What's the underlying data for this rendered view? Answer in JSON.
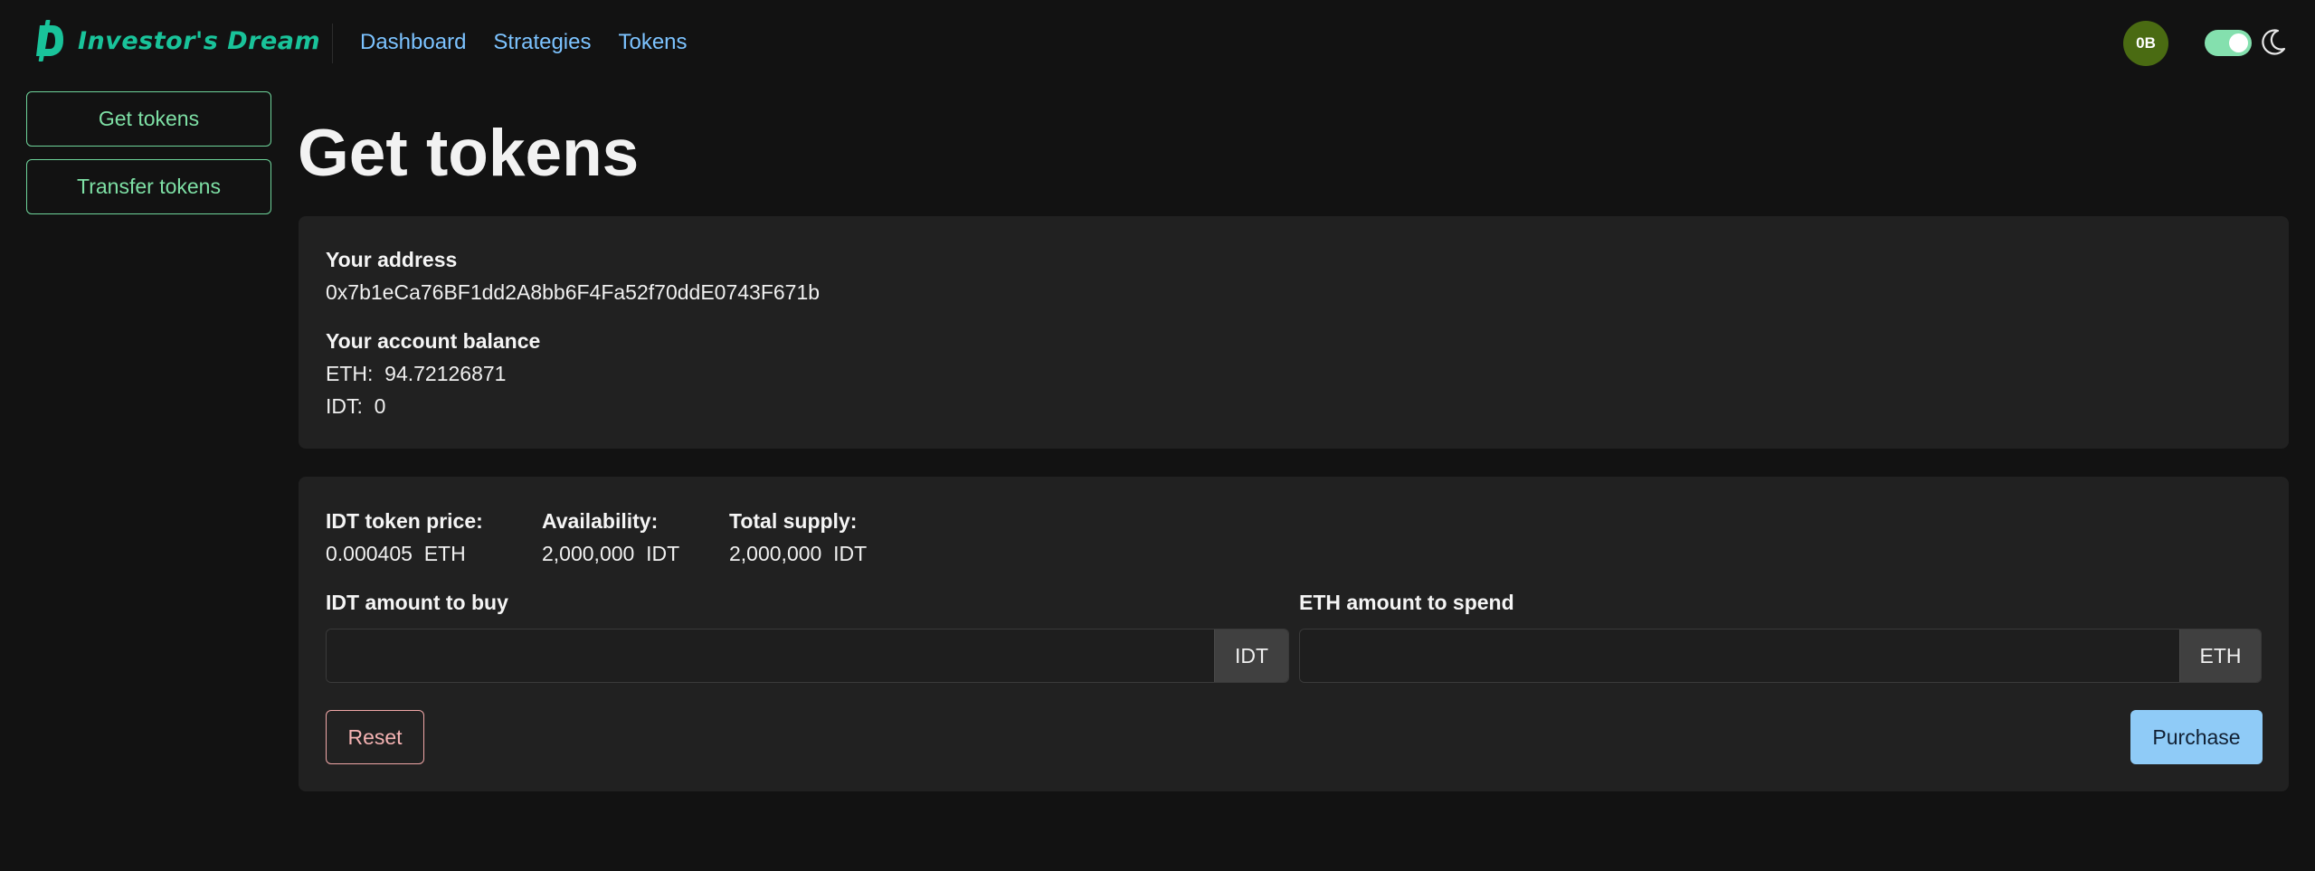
{
  "app": {
    "name": "Investor's Dream",
    "brand_color": "#19c39a"
  },
  "nav": {
    "links": [
      "Dashboard",
      "Strategies",
      "Tokens"
    ]
  },
  "user": {
    "initials": "0B",
    "theme_toggle_on": true
  },
  "sidebar": {
    "items": [
      {
        "label": "Get tokens"
      },
      {
        "label": "Transfer tokens"
      }
    ]
  },
  "page": {
    "title": "Get tokens"
  },
  "account": {
    "address_label": "Your address",
    "address": "0x7b1eCa76BF1dd2A8bb6F4Fa52f70ddE0743F671b",
    "balance_label": "Your account balance",
    "eth_line": "ETH:  94.72126871",
    "idt_line": "IDT:  0"
  },
  "token": {
    "price_label": "IDT token price:",
    "price_value": "0.000405  ETH",
    "availability_label": "Availability:",
    "availability_value": "2,000,000  IDT",
    "supply_label": "Total supply:",
    "supply_value": "2,000,000  IDT"
  },
  "purchase_form": {
    "idt_label": "IDT amount to buy",
    "idt_value": "",
    "idt_addon": "IDT",
    "eth_label": "ETH amount to spend",
    "eth_value": "",
    "eth_addon": "ETH",
    "reset_label": "Reset",
    "purchase_label": "Purchase"
  }
}
